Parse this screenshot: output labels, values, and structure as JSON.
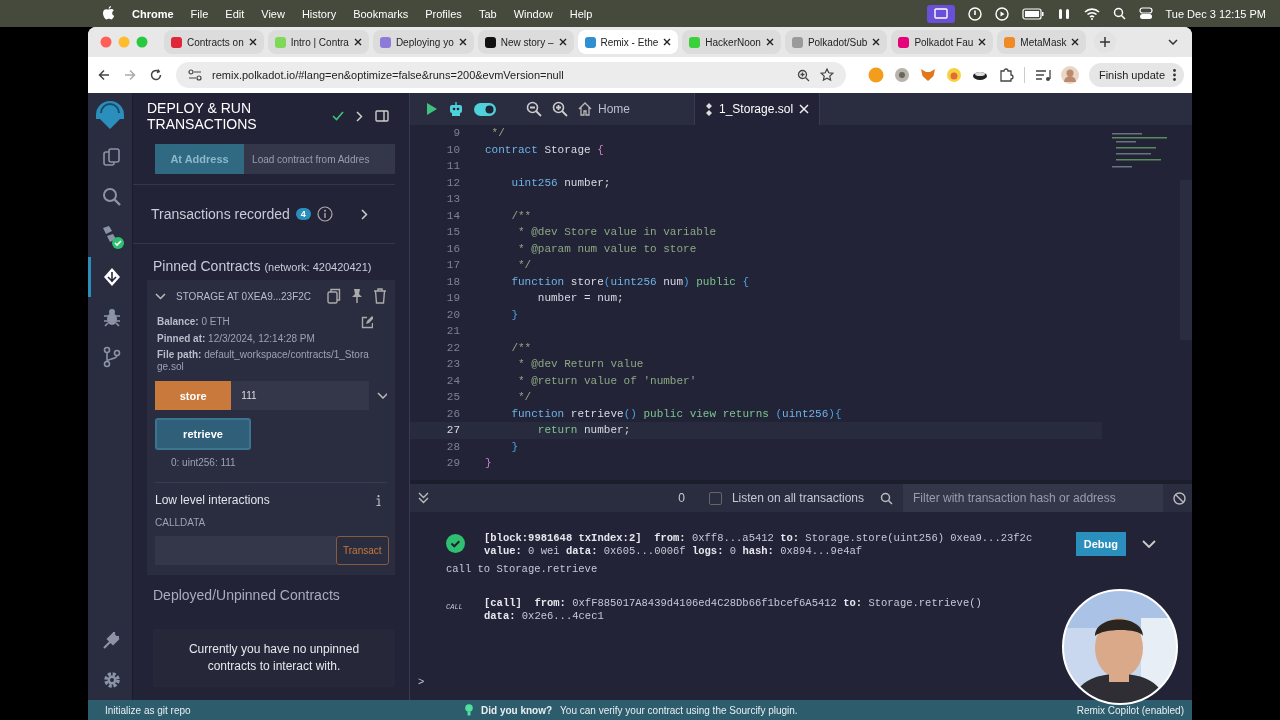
{
  "menu_bar": {
    "app": "Chrome",
    "items": [
      "File",
      "Edit",
      "View",
      "History",
      "Bookmarks",
      "Profiles",
      "Tab",
      "Window",
      "Help"
    ],
    "clock": "Tue Dec 3  12:15 PM"
  },
  "browser": {
    "tabs": [
      {
        "label": "Contracts on",
        "color": "#e0263a",
        "selected": false
      },
      {
        "label": "Intro | Contra",
        "color": "#7ed957",
        "selected": false
      },
      {
        "label": "Deploying yo",
        "color": "#8e7ad8",
        "selected": false
      },
      {
        "label": "New story –",
        "color": "#111111",
        "selected": false
      },
      {
        "label": "Remix - Ethe",
        "color": "#2f8fd1",
        "selected": true
      },
      {
        "label": "HackerNoon",
        "color": "#3ad13a",
        "selected": false
      },
      {
        "label": "Polkadot/Sub",
        "color": "#9a9a9a",
        "selected": false
      },
      {
        "label": "Polkadot Fau",
        "color": "#e6007a",
        "selected": false
      },
      {
        "label": "MetaMask",
        "color": "#f08a24",
        "selected": false
      }
    ],
    "url": "remix.polkadot.io/#lang=en&optimize=false&runs=200&evmVersion=null",
    "update_button": "Finish update"
  },
  "activity_bar": {
    "items": [
      {
        "kind": "files",
        "selected": false
      },
      {
        "kind": "search",
        "selected": false
      },
      {
        "kind": "compiler",
        "selected": false
      },
      {
        "kind": "deploy",
        "selected": true
      },
      {
        "kind": "debugger",
        "selected": false
      },
      {
        "kind": "git",
        "selected": false
      }
    ],
    "bottom": [
      {
        "kind": "plugins"
      },
      {
        "kind": "settings"
      }
    ]
  },
  "side_panel": {
    "title": "DEPLOY & RUN TRANSACTIONS",
    "at_address_button": "At Address",
    "address_placeholder": "Load contract from Addres",
    "transactions": {
      "label": "Transactions recorded",
      "count": "4"
    },
    "pinned": {
      "title": "Pinned Contracts",
      "network": "(network: 420420421)",
      "contract": {
        "name": "STORAGE AT 0XEA9...23F2C",
        "expanded": true,
        "details": [
          "**Balance:** 0 ETH",
          "**Pinned at:** 12/3/2024, 12:14:28 PM",
          "**File path:** default_workspace/contracts/1_Storage.sol"
        ],
        "functions": [
          {
            "kind": "transact",
            "label": "store",
            "value": "111"
          },
          {
            "kind": "call",
            "label": "retrieve",
            "result": "0: uint256: 111"
          }
        ],
        "low_level": {
          "title": "Low level interactions",
          "calldata_label": "CALLDATA",
          "transact_button": "Transact"
        }
      }
    },
    "unpinned": {
      "title": "Deployed/Unpinned Contracts",
      "message": "Currently you have no unpinned contracts to interact with."
    }
  },
  "editor": {
    "toggle": {
      "on": true
    },
    "home_tab": "Home",
    "file_tab": "1_Storage.sol",
    "lines": [
      {
        "num": "9",
        "tokens": [
          {
            "kind": "comment",
            "text": " */"
          }
        ]
      },
      {
        "num": "10",
        "tokens": [
          {
            "kind": "kw",
            "text": "contract"
          },
          {
            "kind": "plain",
            "text": " Storage "
          },
          {
            "kind": "brace",
            "text": "{"
          }
        ]
      },
      {
        "num": "11"
      },
      {
        "num": "12",
        "tokens": [
          {
            "kind": "kw",
            "text": "    uint256"
          },
          {
            "kind": "plain",
            "text": " number;"
          }
        ]
      },
      {
        "num": "13"
      },
      {
        "num": "14",
        "tokens": [
          {
            "kind": "comment",
            "text": "    /**"
          }
        ]
      },
      {
        "num": "15",
        "tokens": [
          {
            "kind": "comment",
            "text": "     * @dev Store value in variable"
          }
        ]
      },
      {
        "num": "16",
        "tokens": [
          {
            "kind": "comment",
            "text": "     * @param num value to store"
          }
        ]
      },
      {
        "num": "17",
        "tokens": [
          {
            "kind": "comment",
            "text": "     */"
          }
        ]
      },
      {
        "num": "18",
        "tokens": [
          {
            "kind": "kw",
            "text": "    function"
          },
          {
            "kind": "plain",
            "text": " store"
          },
          {
            "kind": "paren",
            "text": "("
          },
          {
            "kind": "kw",
            "text": "uint256"
          },
          {
            "kind": "plain",
            "text": " num"
          },
          {
            "kind": "paren",
            "text": ")"
          },
          {
            "kind": "mod",
            "text": " public"
          },
          {
            "kind": "paren",
            "text": " {"
          }
        ]
      },
      {
        "num": "19",
        "tokens": [
          {
            "kind": "plain",
            "text": "        number = num;"
          }
        ]
      },
      {
        "num": "20",
        "tokens": [
          {
            "kind": "paren",
            "text": "    }"
          }
        ]
      },
      {
        "num": "21"
      },
      {
        "num": "22",
        "tokens": [
          {
            "kind": "comment",
            "text": "    /**"
          }
        ]
      },
      {
        "num": "23",
        "tokens": [
          {
            "kind": "comment",
            "text": "     * @dev Return value"
          }
        ]
      },
      {
        "num": "24",
        "tokens": [
          {
            "kind": "comment",
            "text": "     * @return value of 'number'"
          }
        ]
      },
      {
        "num": "25",
        "tokens": [
          {
            "kind": "comment",
            "text": "     */"
          }
        ]
      },
      {
        "num": "26",
        "tokens": [
          {
            "kind": "kw",
            "text": "    function"
          },
          {
            "kind": "plain",
            "text": " retrieve"
          },
          {
            "kind": "paren",
            "text": "()"
          },
          {
            "kind": "mod",
            "text": " public view returns"
          },
          {
            "kind": "paren",
            "text": " ("
          },
          {
            "kind": "kw",
            "text": "uint256"
          },
          {
            "kind": "paren",
            "text": "){"
          }
        ]
      },
      {
        "num": "27",
        "current": true,
        "tokens": [
          {
            "kind": "mod",
            "text": "        return"
          },
          {
            "kind": "plain",
            "text": " number;"
          }
        ]
      },
      {
        "num": "28",
        "tokens": [
          {
            "kind": "paren",
            "text": "    }"
          }
        ]
      },
      {
        "num": "29",
        "tokens": [
          {
            "kind": "brace",
            "text": "}"
          }
        ]
      }
    ]
  },
  "terminal": {
    "pending_count": "0",
    "listen": {
      "label": "Listen on all transactions",
      "checked": false
    },
    "filter_placeholder": "Filter with transaction hash or address",
    "entries": [
      {
        "kind": "tx",
        "lines": [
          "**[block:9981648 txIndex:2]  from:** 0xff8...a5412 **to:** Storage.store(uint256) 0xea9...23f2c",
          "**value:** 0 wei **data:** 0x605...0006f **logs:** 0 **hash:** 0x894...9e4af"
        ],
        "debug_button": "Debug",
        "note": "call to Storage.retrieve"
      },
      {
        "kind": "call",
        "badge": "CALL",
        "lines": [
          "**[call]  from:** 0xfF885017A8439d4106ed4C28Db66f1bcef6A5412 **to:** Storage.retrieve()",
          "**data:** 0x2e6...4cec1"
        ]
      }
    ],
    "prompt": ">"
  },
  "status_bar": {
    "git": "Initialize as git repo",
    "tip_title": "Did you know?",
    "tip": "You can verify your contract using the Sourcify plugin.",
    "copilot": "Remix Copilot (enabled)"
  }
}
